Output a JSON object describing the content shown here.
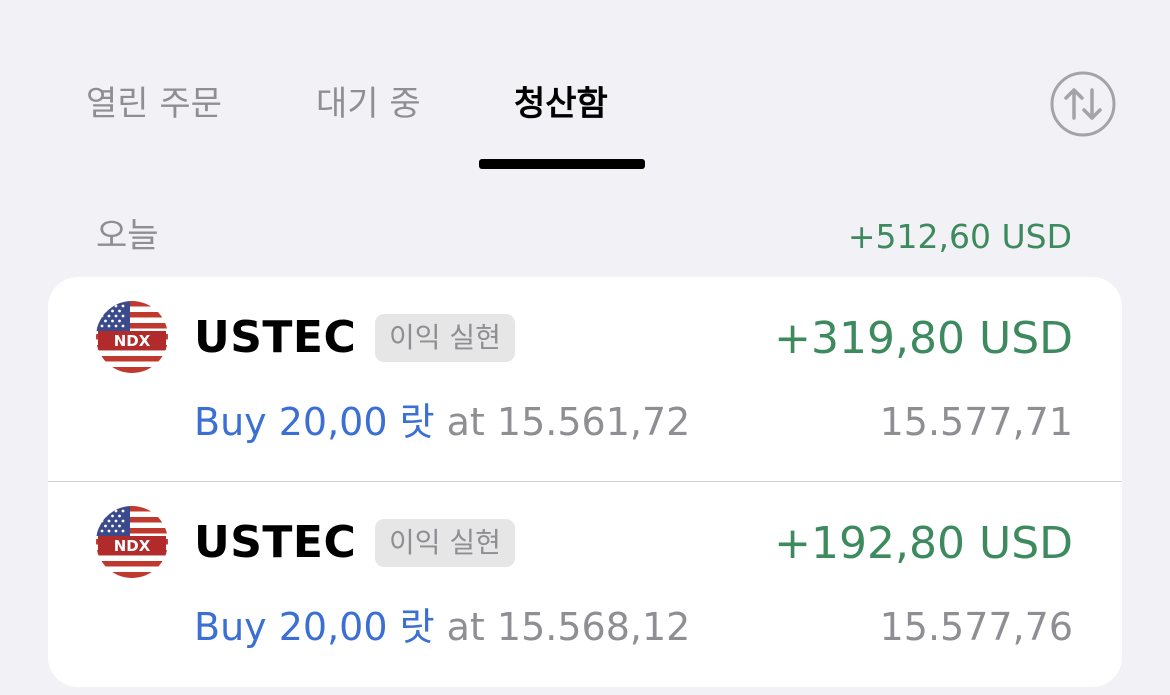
{
  "tabs": [
    {
      "label": "열린 주문",
      "active": false
    },
    {
      "label": "대기 중",
      "active": false
    },
    {
      "label": "청산함",
      "active": true
    }
  ],
  "sort_icon": "sort-arrows-icon",
  "section": {
    "label": "오늘",
    "total": "+512,60 USD"
  },
  "colors": {
    "profit": "#3d8a5e",
    "buy": "#3c6fd4",
    "muted": "#8e8e93",
    "background": "#f2f1f6"
  },
  "positions": [
    {
      "flag_icon": "us-flag-icon",
      "flag_text": "NDX",
      "symbol": "USTEC",
      "badge": "이익 실현",
      "pnl": "+319,80 USD",
      "side_volume": "Buy 20,00 랏",
      "at": "at",
      "open_price": "15.561,72",
      "close_price": "15.577,71"
    },
    {
      "flag_icon": "us-flag-icon",
      "flag_text": "NDX",
      "symbol": "USTEC",
      "badge": "이익 실현",
      "pnl": "+192,80 USD",
      "side_volume": "Buy 20,00 랏",
      "at": "at",
      "open_price": "15.568,12",
      "close_price": "15.577,76"
    }
  ]
}
